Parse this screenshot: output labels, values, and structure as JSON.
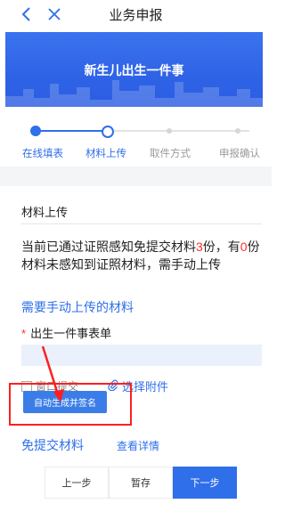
{
  "nav": {
    "title": "业务申报",
    "back_icon": "chevron-left-icon",
    "close_icon": "close-icon"
  },
  "banner": {
    "title": "新生儿出生一件事"
  },
  "steps": [
    {
      "label": "在线填表",
      "state": "done"
    },
    {
      "label": "材料上传",
      "state": "current"
    },
    {
      "label": "取件方式",
      "state": "todo"
    },
    {
      "label": "申报确认",
      "state": "todo"
    }
  ],
  "section": {
    "title": "材料上传"
  },
  "notice": {
    "part1": "当前已通过证照感知免提交材料",
    "count_received": "3",
    "part2": "份，有",
    "count_missing": "0",
    "part3": "份材料未感知到证照材料，需手动上传"
  },
  "upload": {
    "heading": "需要手动上传的材料",
    "required_mark": "*",
    "field_label": "出生一件事表单",
    "window_label": "窗口提交",
    "attach_label": "选择附件",
    "auto_button": "自动生成并签名"
  },
  "free": {
    "title": "免提交材料",
    "view_detail": "查看详情"
  },
  "actions": {
    "prev": "上一步",
    "save": "暂存",
    "next": "下一步"
  },
  "colors": {
    "accent": "#2f6fe9",
    "highlight": "#ff1f1f"
  }
}
